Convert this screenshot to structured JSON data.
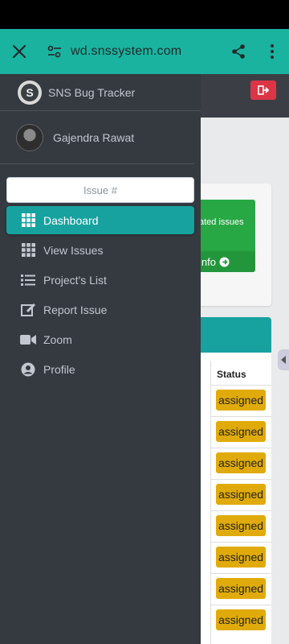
{
  "browser": {
    "url": "wd.snssystem.com"
  },
  "sidebar": {
    "brand": {
      "logo_letter": "S",
      "name": "SNS Bug Tracker"
    },
    "user": {
      "name": "Gajendra Rawat"
    },
    "search": {
      "placeholder": "Issue #"
    },
    "items": [
      {
        "label": "Dashboard",
        "icon": "grid-icon",
        "active": true
      },
      {
        "label": "View Issues",
        "icon": "grid-icon",
        "active": false
      },
      {
        "label": "Project's List",
        "icon": "list-icon",
        "active": false
      },
      {
        "label": "Report Issue",
        "icon": "edit-icon",
        "active": false
      },
      {
        "label": "Zoom",
        "icon": "video-icon",
        "active": false
      },
      {
        "label": "Profile",
        "icon": "user-circle-icon",
        "active": false
      }
    ]
  },
  "background": {
    "info_box": {
      "text": "ated issues",
      "footer": "info"
    },
    "table": {
      "status_header": "Status",
      "statuses": [
        "assigned",
        "assigned",
        "assigned",
        "assigned",
        "assigned",
        "assigned",
        "assigned",
        "assigned"
      ]
    }
  },
  "colors": {
    "accent": "#17a2a0",
    "drawer": "#343a40",
    "badge": "#e0ab0a",
    "danger": "#dc3545",
    "success": "#28a745"
  }
}
